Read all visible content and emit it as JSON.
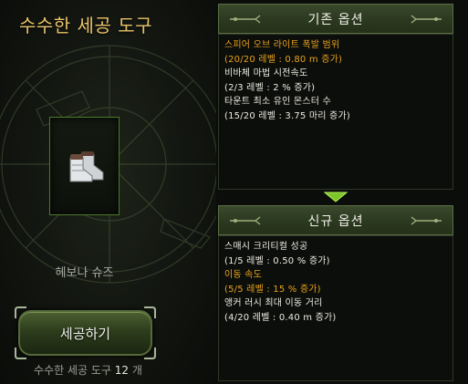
{
  "title": "수수한 세공 도구",
  "item": {
    "name": "헤보나 슈즈"
  },
  "craft_button": {
    "label": "세공하기"
  },
  "tool_count": {
    "label": "수수한 세공 도구",
    "value": "12",
    "unit": "개"
  },
  "existing": {
    "header": "기존 옵션",
    "options": [
      {
        "name": "스피어 오브 라이트 폭발 범위",
        "detail": "(20/20 레벨 : 0.80 m 증가)",
        "highlight": true
      },
      {
        "name": "비바체 마법 시전속도",
        "detail": "(2/3 레벨 : 2 % 증가)",
        "highlight": false
      },
      {
        "name": "타운트 최소 유인 몬스터 수",
        "detail": "(15/20 레벨 : 3.75 마리 증가)",
        "highlight": false
      }
    ]
  },
  "new": {
    "header": "신규 옵션",
    "options": [
      {
        "name": "스매시 크리티컬 성공",
        "detail": "(1/5 레벨 : 0.50 % 증가)",
        "highlight": false
      },
      {
        "name": "이동 속도",
        "detail": "(5/5 레벨 : 15 % 증가)",
        "highlight": true
      },
      {
        "name": "앵커 러시 최대 이동 거리",
        "detail": "(4/20 레벨 : 0.40 m 증가)",
        "highlight": false
      }
    ]
  },
  "colors": {
    "gold": "#e8a21c",
    "title": "#e9c46a",
    "accent_green": "#7cc62a"
  }
}
